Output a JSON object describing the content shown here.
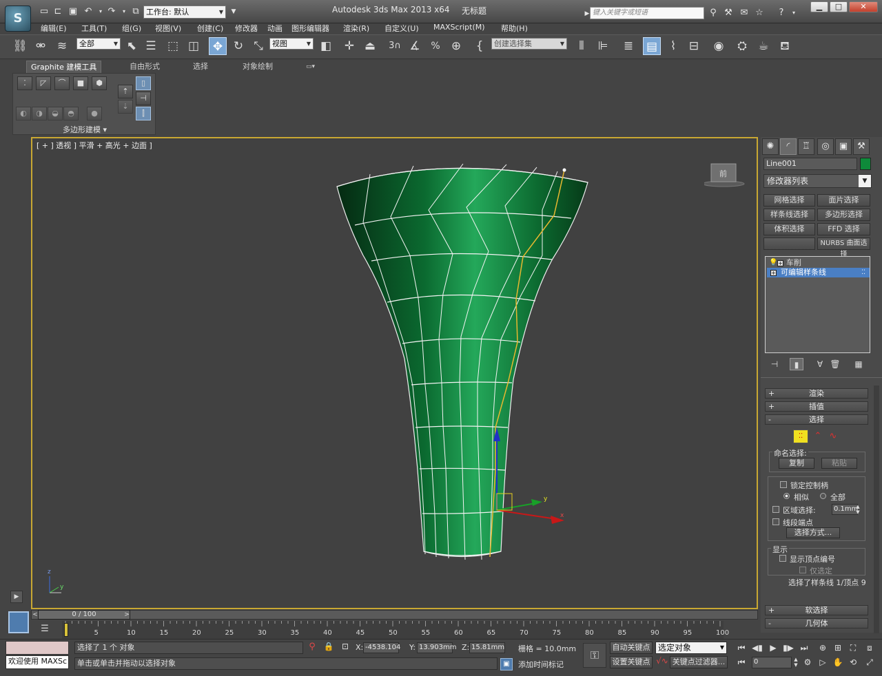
{
  "titlebar": {
    "app_title": "Autodesk 3ds Max  2013 x64",
    "doc_title": "无标题",
    "workspace": "工作台: 默认",
    "search_placeholder": "键入关键字或短语",
    "logo_letter": "S"
  },
  "menu": [
    "编辑(E)",
    "工具(T)",
    "组(G)",
    "视图(V)",
    "创建(C)",
    "修改器",
    "动画",
    "图形编辑器",
    "渲染(R)",
    "自定义(U)",
    "MAXScript(M)",
    "帮助(H)"
  ],
  "toolbar": {
    "selection_filter": "全部",
    "ref_coord": "视图",
    "named_selection": "创建选择集",
    "spinner_snap_label": "3",
    "angle_label": "%"
  },
  "ribbon": {
    "tabs": [
      "Graphite 建模工具",
      "自由形式",
      "选择",
      "对象绘制"
    ],
    "panel_label": "多边形建模"
  },
  "viewport": {
    "label": "[ + ] 透视 ] 平滑 + 高光 + 边面 ]",
    "viewcube_label": "前",
    "axis_x": "x",
    "axis_y": "y",
    "axis_z": "z",
    "world_axis_z": "z",
    "world_axis_y": "y"
  },
  "command_panel": {
    "object_name": "Line001",
    "object_color": "#0e8a3a",
    "modifier_list": "修改器列表",
    "mod_buttons": [
      "网格选择",
      "面片选择",
      "样条线选择",
      "多边形选择",
      "体积选择",
      "FFD 选择",
      "",
      "NURBS 曲面选择"
    ],
    "stack": [
      "车削",
      "可编辑样条线"
    ],
    "rollouts": {
      "render": "渲染",
      "interp": "插值",
      "selection": "选择",
      "soft_sel": "软选择",
      "geometry": "几何体"
    },
    "named_sel_label": "命名选择:",
    "copy": "复制",
    "paste": "粘贴",
    "lock_handles": "锁定控制柄",
    "similar": "相似",
    "all": "全部",
    "area_sel": "区域选择:",
    "area_value": "0.1mm",
    "seg_end": "线段端点",
    "sel_by": "选择方式...",
    "display_label": "显示",
    "show_vert_num": "显示顶点编号",
    "only_sel": "仅选定",
    "sel_status": "选择了样条线 1/顶点 9"
  },
  "timeline": {
    "range": "0 / 100",
    "ticks": [
      "5",
      "10",
      "15",
      "20",
      "25",
      "30",
      "35",
      "40",
      "45",
      "50",
      "55",
      "60",
      "65",
      "70",
      "75",
      "80",
      "85",
      "90",
      "95",
      "100"
    ]
  },
  "status": {
    "welcome": "欢迎使用 MAXSc",
    "selected": "选择了 1 个 对象",
    "prompt": "单击或单击并拖动以选择对象",
    "x_label": "X:",
    "x_value": "-4538.104",
    "y_label": "Y:",
    "y_value": "13.903mm",
    "z_label": "Z:",
    "z_value": "15.81mm",
    "grid": "栅格 = 10.0mm",
    "add_time_tag": "添加时间标记",
    "auto_key": "自动关键点",
    "set_key": "设置关键点",
    "key_mode": "选定对象",
    "key_filters": "关键点过滤器...",
    "frame": "0"
  }
}
